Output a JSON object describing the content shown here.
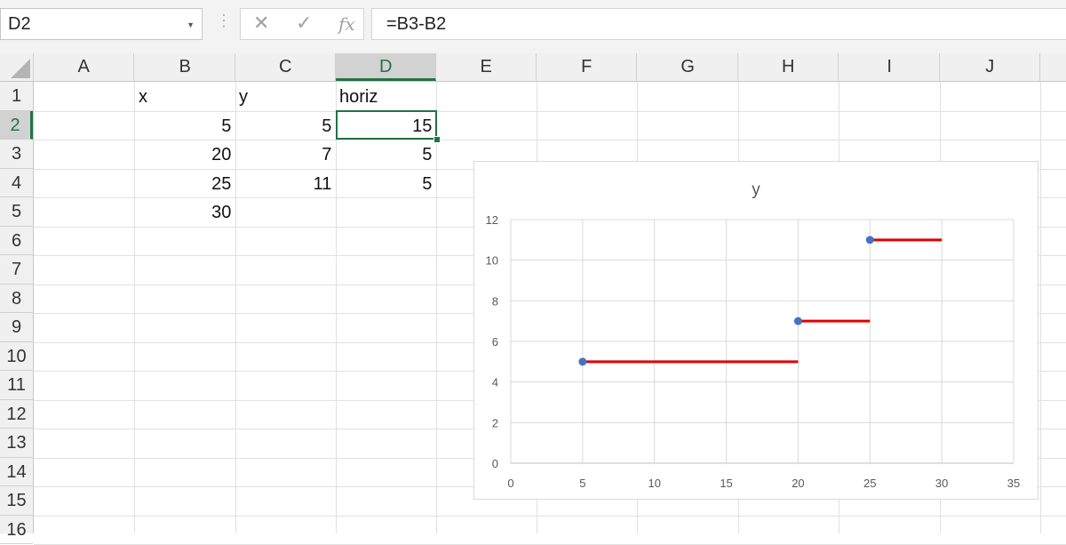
{
  "name_box": {
    "value": "D2"
  },
  "formula_bar": {
    "cancel_glyph": "✕",
    "enter_glyph": "✓",
    "fx_label": "fx",
    "formula": "=B3-B2"
  },
  "columns": [
    "A",
    "B",
    "C",
    "D",
    "E",
    "F",
    "G",
    "H",
    "I",
    "J"
  ],
  "rows": [
    "1",
    "2",
    "3",
    "4",
    "5",
    "6",
    "7",
    "8",
    "9",
    "10",
    "11",
    "12",
    "13",
    "14",
    "15",
    "16"
  ],
  "selected": {
    "column": "D",
    "row": "2"
  },
  "cells": {
    "B1": "x",
    "C1": "y",
    "D1": "horiz",
    "B2": "5",
    "C2": "5",
    "D2": "15",
    "B3": "20",
    "C3": "7",
    "D3": "5",
    "B4": "25",
    "C4": "11",
    "D4": "5",
    "B5": "30"
  },
  "colors": {
    "accent": "#217346",
    "marker": "#4472c4",
    "error_bar": "#e00000",
    "gridline": "#d9d9d9"
  },
  "chart_data": {
    "type": "scatter",
    "title": "y",
    "xlabel": "",
    "ylabel": "",
    "xlim": [
      0,
      35
    ],
    "ylim": [
      0,
      12
    ],
    "x_ticks": [
      0,
      5,
      10,
      15,
      20,
      25,
      30,
      35
    ],
    "y_ticks": [
      0,
      2,
      4,
      6,
      8,
      10,
      12
    ],
    "grid": true,
    "legend": "none",
    "series": [
      {
        "x": [
          5,
          20,
          25
        ],
        "y": [
          5,
          7,
          11
        ],
        "horizontal_error_plus": [
          15,
          5,
          5
        ]
      }
    ]
  }
}
